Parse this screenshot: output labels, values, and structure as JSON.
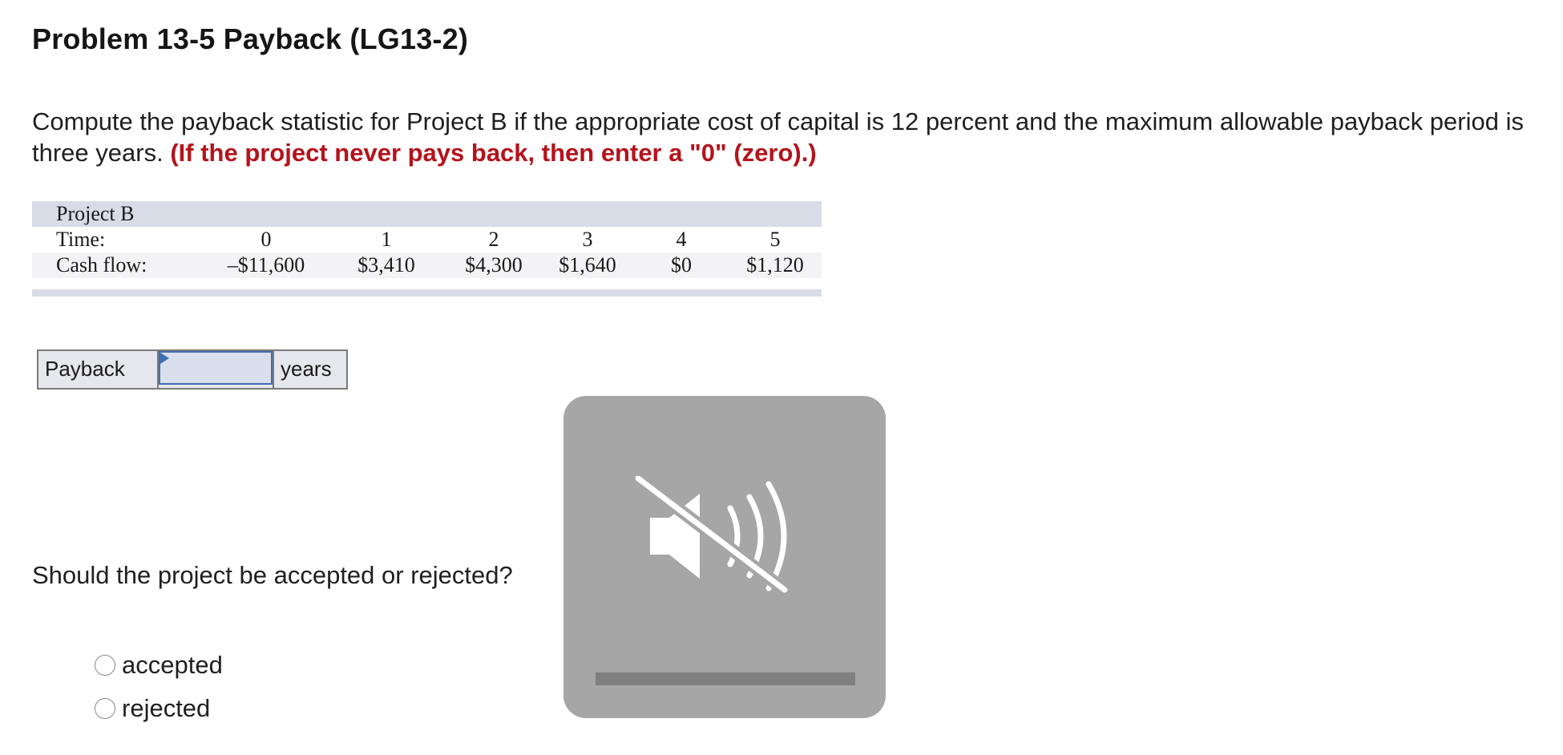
{
  "problem": {
    "title": "Problem 13-5 Payback (LG13-2)",
    "question_text": "Compute the payback statistic for Project B if the appropriate cost of capital is 12 percent and the maximum allowable payback period is three years.",
    "question_note": "(If the project never pays back, then enter a \"0\" (zero).)"
  },
  "table": {
    "project_label": "Project B",
    "time_label": "Time:",
    "cashflow_label": "Cash flow:",
    "times": [
      "0",
      "1",
      "2",
      "3",
      "4",
      "5"
    ],
    "cash_flows": [
      "–$11,600",
      "$3,410",
      "$4,300",
      "$1,640",
      "$0",
      "$1,120"
    ]
  },
  "payback": {
    "label": "Payback",
    "value": "",
    "unit": "years"
  },
  "decision": {
    "question": "Should the project be accepted or rejected?",
    "options": [
      "accepted",
      "rejected"
    ]
  },
  "media": {
    "icon": "speaker-muted-icon",
    "overlay_color": "#a6a6a6"
  },
  "colors": {
    "note_red": "#b5121b",
    "table_band": "#d8dce6",
    "input_border": "#3e6fb0"
  }
}
